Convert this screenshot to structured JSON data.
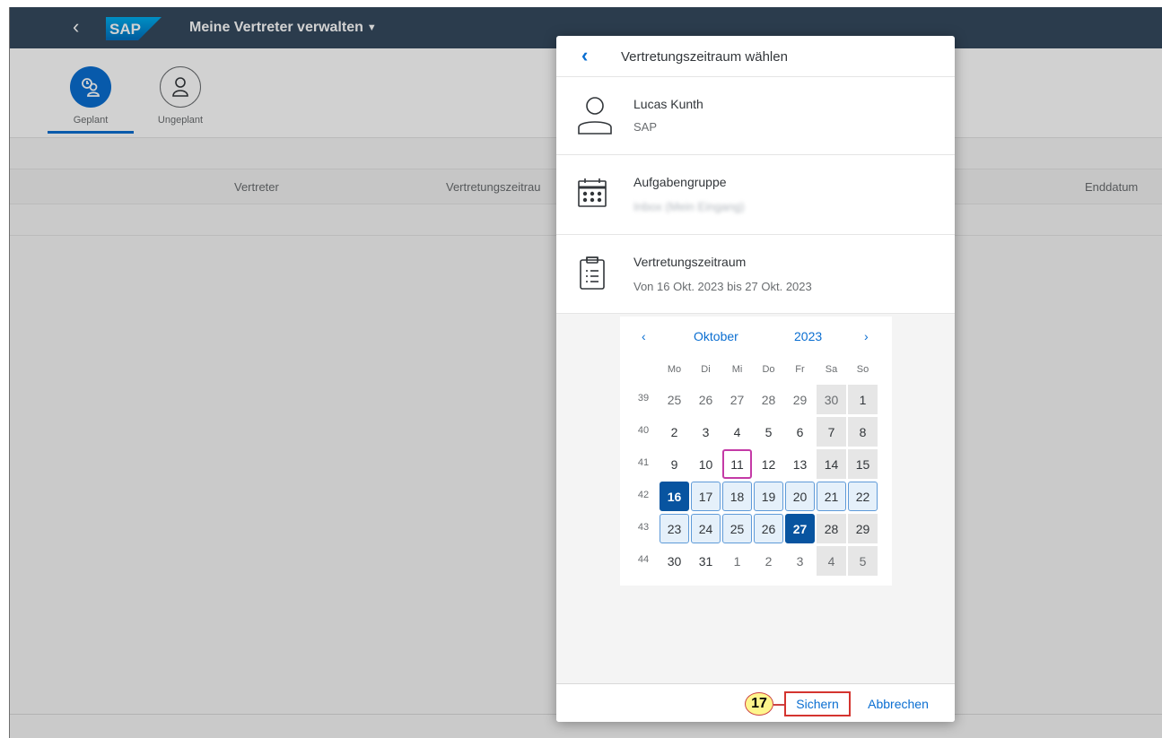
{
  "shell": {
    "logo_text": "SAP",
    "app_title": "Meine Vertreter verwalten",
    "colors": {
      "shellbar": "#354a5f",
      "accent": "#0a6ed1"
    }
  },
  "tabs": [
    {
      "label": "Geplant",
      "icon": "people-schedule-icon",
      "active": true
    },
    {
      "label": "Ungeplant",
      "icon": "person-icon",
      "active": false
    }
  ],
  "table": {
    "columns": [
      "Vertreter",
      "Vertretungszeitrau",
      "Enddatum"
    ]
  },
  "dialog": {
    "title": "Vertretungszeitraum wählen",
    "person": {
      "name": "Lucas Kunth",
      "company": "SAP",
      "icon": "person-icon"
    },
    "task_group": {
      "label": "Aufgabengruppe",
      "value": "Inbox (Mein Eingang)",
      "icon": "calendar-icon"
    },
    "period": {
      "label": "Vertretungszeitraum",
      "value": "Von 16 Okt. 2023 bis 27 Okt. 2023",
      "icon": "clipboard-list-icon"
    },
    "calendar": {
      "month": "Oktober",
      "year": "2023",
      "weekdays": [
        "Mo",
        "Di",
        "Mi",
        "Do",
        "Fr",
        "Sa",
        "So"
      ],
      "weeks": [
        {
          "no": "39",
          "days": [
            "25",
            "26",
            "27",
            "28",
            "29",
            "30",
            "1"
          ]
        },
        {
          "no": "40",
          "days": [
            "2",
            "3",
            "4",
            "5",
            "6",
            "7",
            "8"
          ]
        },
        {
          "no": "41",
          "days": [
            "9",
            "10",
            "11",
            "12",
            "13",
            "14",
            "15"
          ]
        },
        {
          "no": "42",
          "days": [
            "16",
            "17",
            "18",
            "19",
            "20",
            "21",
            "22"
          ]
        },
        {
          "no": "43",
          "days": [
            "23",
            "24",
            "25",
            "26",
            "27",
            "28",
            "29"
          ]
        },
        {
          "no": "44",
          "days": [
            "30",
            "31",
            "1",
            "2",
            "3",
            "4",
            "5"
          ]
        }
      ],
      "range_start": "16",
      "range_end": "27",
      "today": "11",
      "colors": {
        "selected": "#0854a0",
        "range": "#e5f0fa",
        "today_border": "#c43aa6",
        "weekend": "#e6e6e6"
      }
    },
    "footer": {
      "step_number": "17",
      "save_label": "Sichern",
      "cancel_label": "Abbrechen"
    }
  }
}
